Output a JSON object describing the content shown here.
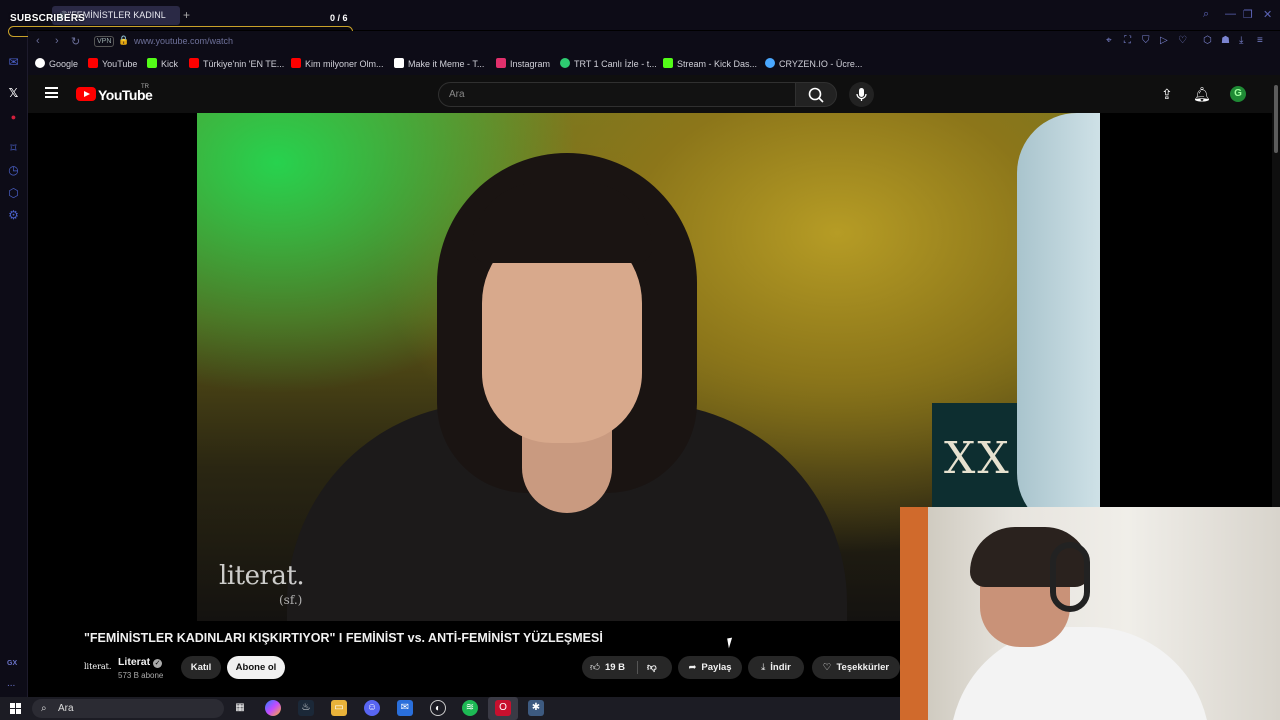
{
  "browser": {
    "tab_title": "\"FEMİNİSTLER KADINL",
    "url": "www.youtube.com/watch",
    "vpn_label": "VPN",
    "sidebar_label_gx": "GX",
    "sidebar_label_more": "...",
    "bookmarks": [
      {
        "label": "Google",
        "color": "#ffffff"
      },
      {
        "label": "YouTube",
        "color": "#ff0000"
      },
      {
        "label": "Kick",
        "color": "#53fc18"
      },
      {
        "label": "Türkiye'nin 'EN TE...",
        "color": "#ff0000"
      },
      {
        "label": "Kim milyoner Olm...",
        "color": "#ff0000"
      },
      {
        "label": "Make it Meme - T...",
        "color": "#ffffff"
      },
      {
        "label": "Instagram",
        "color": "#e1306c"
      },
      {
        "label": "TRT 1 Canlı İzle - t...",
        "color": "#2ecc71"
      },
      {
        "label": "Stream - Kick Das...",
        "color": "#53fc18"
      },
      {
        "label": "CRYZEN.IO - Ücre...",
        "color": "#4aa8ff"
      }
    ]
  },
  "overlay": {
    "goal_title": "SUBSCRIBERS",
    "goal_count": "0 / 6",
    "goal_progress": 0.0
  },
  "youtube": {
    "logo_text": "YouTube",
    "country_code": "TR",
    "search_placeholder": "Ara",
    "account_initial": "G",
    "video": {
      "title": "\"FEMİNİSTLER KADINLARI KIŞKIRTIYOR\" I FEMİNİST vs. ANTİ-FEMİNİST YÜZLEŞMESİ",
      "watermark_brand": "literat.",
      "watermark_sub": "(sf.)",
      "poster_text": "XX"
    },
    "channel": {
      "avatar_text": "literat.",
      "name": "Literat",
      "subscribers": "573 B abone",
      "join_label": "Katıl",
      "subscribe_label": "Abone ol"
    },
    "actions": {
      "like_count": "19 B",
      "share_label": "Paylaş",
      "download_label": "İndir",
      "thanks_label": "Teşekkürler"
    }
  },
  "taskbar": {
    "search_placeholder": "Ara"
  }
}
